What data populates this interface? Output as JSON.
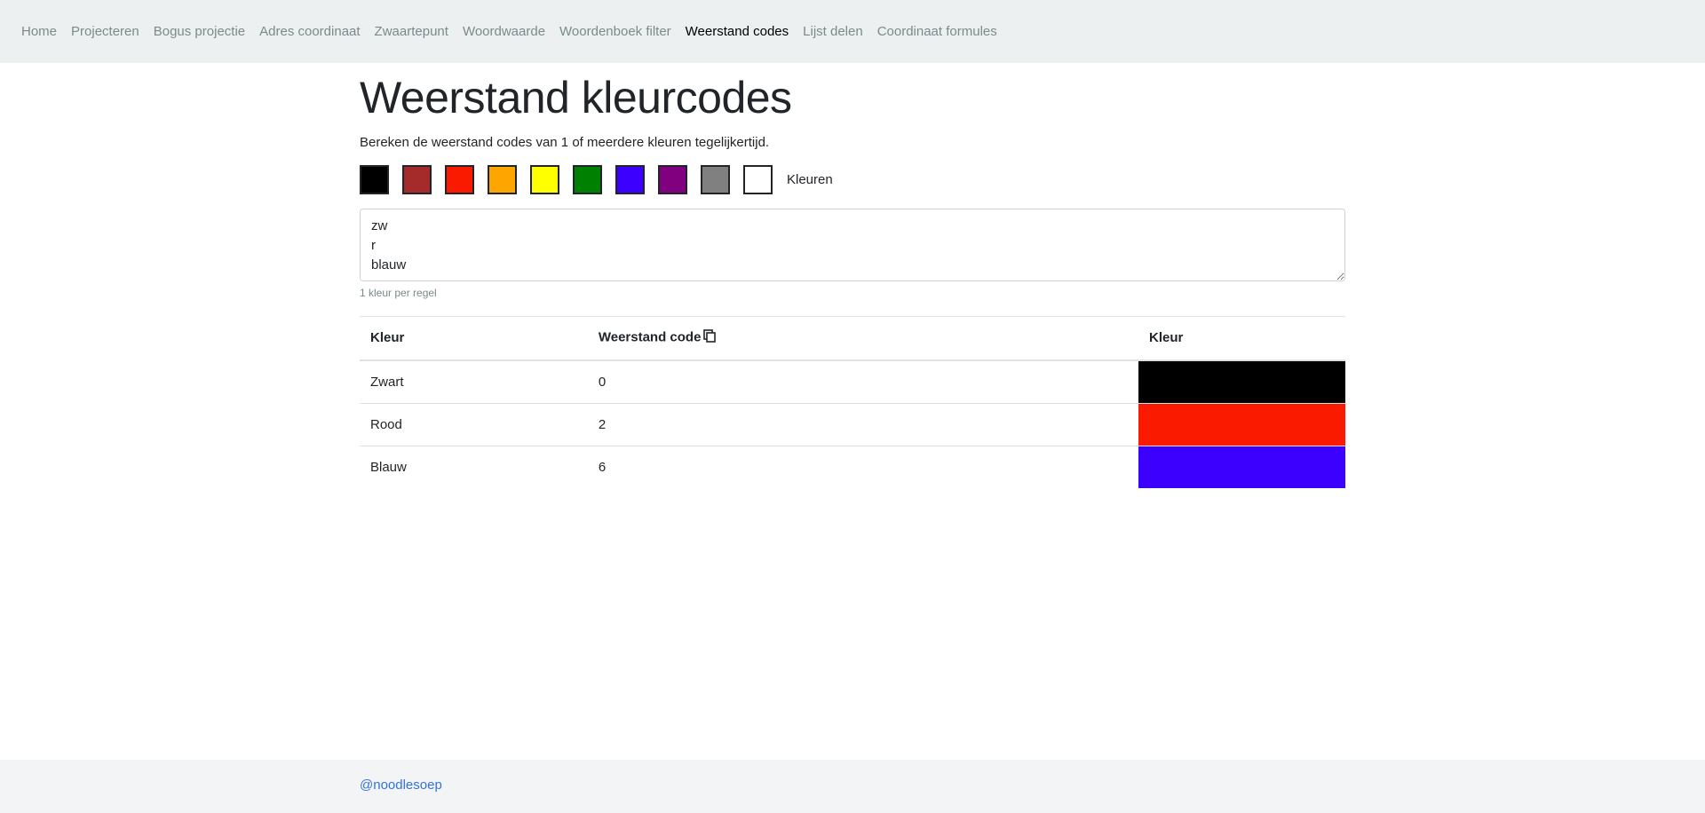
{
  "nav": {
    "items": [
      {
        "label": "Home"
      },
      {
        "label": "Projecteren"
      },
      {
        "label": "Bogus projectie"
      },
      {
        "label": "Adres coordinaat"
      },
      {
        "label": "Zwaartepunt"
      },
      {
        "label": "Woordwaarde"
      },
      {
        "label": "Woordenboek filter"
      },
      {
        "label": "Weerstand codes"
      },
      {
        "label": "Lijst delen"
      },
      {
        "label": "Coordinaat formules"
      }
    ],
    "active_index": 7
  },
  "page": {
    "title": "Weerstand kleurcodes",
    "lead": "Bereken de weerstand codes van 1 of meerdere kleuren tegelijkertijd."
  },
  "swatches": {
    "colors": [
      "#000000",
      "#a52a2a",
      "#f91a00",
      "#ffa500",
      "#ffff00",
      "#008000",
      "#3b00ff",
      "#800080",
      "#808080",
      "#ffffff"
    ],
    "label": "Kleuren"
  },
  "input": {
    "value": "zw\nr\nblauw",
    "help": "1 kleur per regel"
  },
  "table": {
    "headers": {
      "color": "Kleur",
      "code": "Weerstand code",
      "swatch": "Kleur"
    },
    "rows": [
      {
        "name": "Zwart",
        "code": "0",
        "hex": "#000000"
      },
      {
        "name": "Rood",
        "code": "2",
        "hex": "#f91a00"
      },
      {
        "name": "Blauw",
        "code": "6",
        "hex": "#3b00ff"
      }
    ]
  },
  "footer": {
    "link": "@noodlesoep"
  }
}
